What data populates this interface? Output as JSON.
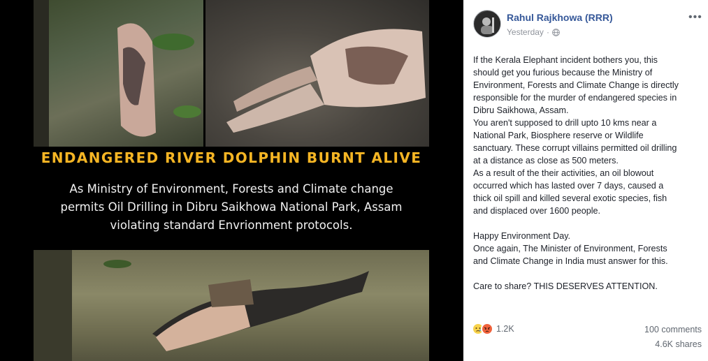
{
  "poster": {
    "headline": "ENDANGERED RIVER DOLPHIN BURNT ALIVE",
    "body_lines": [
      "As Ministry of Environment, Forests and Climate  change",
      "permits Oil Drilling in Dibru Saikhowa National Park, Assam",
      "violating standard Envrionment protocols."
    ],
    "headline_color": "#f5b524"
  },
  "post": {
    "author": "Rahul Rajkhowa (RRR)",
    "timestamp": "Yesterday",
    "privacy_icon": "globe-icon",
    "more_icon": "more-options-icon",
    "paragraphs": [
      [
        "If the Kerala Elephant incident bothers you, this",
        "should get you furious because the Ministry of",
        "Environment, Forests and Climate Change is directly",
        "responsible for the murder of endangered species in",
        "Dibru Saikhowa, Assam.",
        "You aren't supposed to drill upto 10 kms near a",
        "National Park, Biosphere reserve or Wildlife",
        "sanctuary. These corrupt villains permitted oil drilling",
        "at a distance as close as 500 meters.",
        "As a result of the their activities, an oil blowout",
        "occurred which has lasted over 7 days, caused a",
        "thick oil spill and killed several exotic species, fish",
        "and displaced over 1600 people."
      ],
      [
        "Happy Environment Day.",
        "Once again, The Minister of Environment, Forests",
        "and Climate Change in India must answer for this."
      ],
      [
        "Care to share? THIS DESERVES ATTENTION."
      ]
    ],
    "reactions": {
      "icons": [
        "sad-reaction-icon",
        "angry-reaction-icon"
      ],
      "count": "1.2K"
    },
    "comments": "100 comments",
    "shares": "4.6K shares",
    "link_color": "#365899"
  }
}
